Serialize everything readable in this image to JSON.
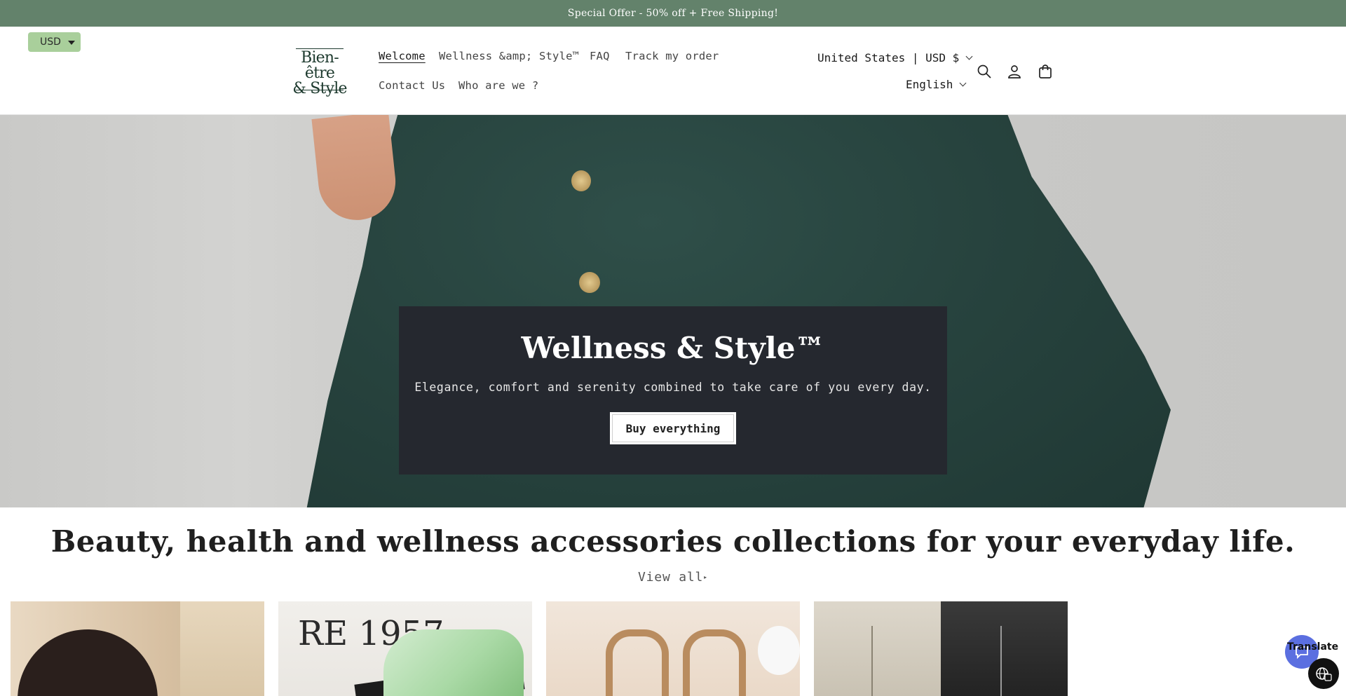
{
  "announcement": "Special Offer - 50% off + Free Shipping!",
  "currency_widget": {
    "label": "USD"
  },
  "logo": {
    "line1": "Bien-être",
    "line2": "& Style"
  },
  "nav": {
    "items": [
      {
        "label": "Welcome",
        "active": true
      },
      {
        "label": "Wellness &amp; Style™"
      },
      {
        "label": "FAQ"
      },
      {
        "label": "Track my order"
      },
      {
        "label": "Contact Us"
      },
      {
        "label": "Who are we ?"
      }
    ]
  },
  "locale": {
    "country_currency": "United States | USD $",
    "language": "English"
  },
  "header_icons": [
    "search-icon",
    "account-icon",
    "cart-icon"
  ],
  "hero": {
    "title": "Wellness & Style™",
    "subtitle": "Elegance, comfort and serenity combined to take care of you every day.",
    "cta_label": "Buy everything"
  },
  "collections": {
    "heading": "Beauty, health and wellness accessories collections for your everyday life.",
    "view_all_label": "View all",
    "tile_text_2": "RE 1957"
  },
  "widgets": {
    "translate_label": "Translate"
  },
  "colors": {
    "announcement_bg": "#63826b",
    "currency_btn_bg": "#a9cf9b",
    "hero_box_bg": "#25282f",
    "chat_btn_bg": "#5b6fe0"
  }
}
